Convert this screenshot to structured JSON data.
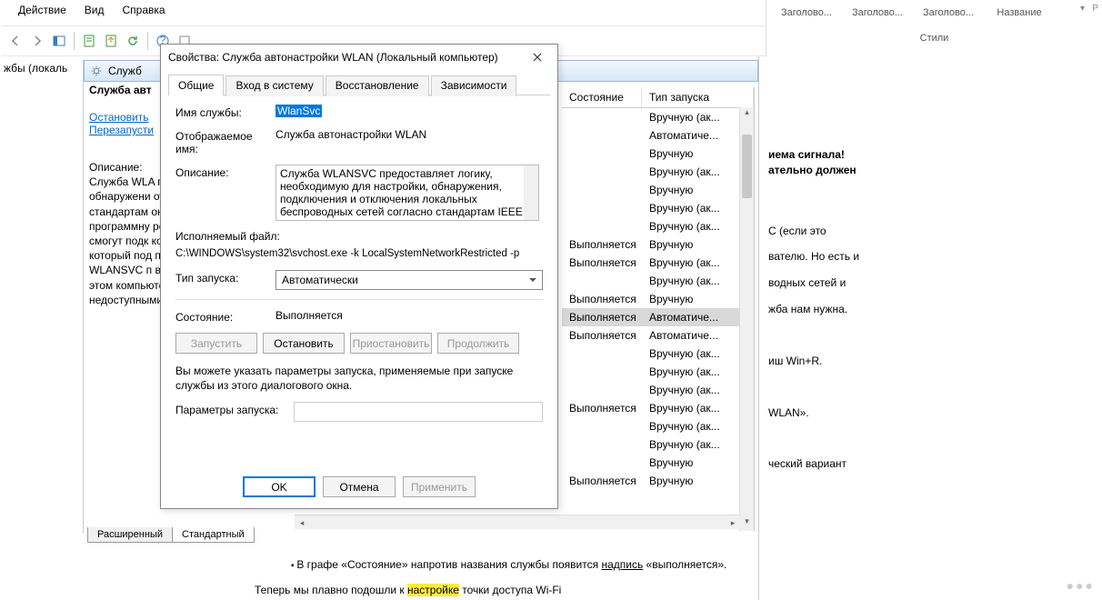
{
  "menu": {
    "action": "Действие",
    "view": "Вид",
    "help": "Справка"
  },
  "styles": {
    "h1": "Заголово...",
    "h2": "Заголово...",
    "h3": "Заголово...",
    "name": "Название",
    "label": "Стили"
  },
  "left_tree": {
    "item": "жбы (локаль"
  },
  "svc_header": {
    "title": "Служб"
  },
  "desc": {
    "title": "Служба авт",
    "stop": "Остановить",
    "restart": "Перезапусти",
    "label": "Описание:",
    "body": "Служба WLA предоставля необходиму обнаружени отключения беспроводн стандартам она содерж превращени программну результате ч устройства н смогут подк компьютеру адаптера бе который под подобную ф или отключ WLANSVC п все адаптер сетей на этом компьютере станут недоступными из раздела"
  },
  "bottom_tabs": {
    "extended": "Расширенный",
    "standard": "Стандартный"
  },
  "columns": {
    "status": "Состояние",
    "startup": "Тип запуска"
  },
  "services": [
    {
      "status": "",
      "startup": "Вручную (ак..."
    },
    {
      "status": "",
      "startup": "Автоматиче..."
    },
    {
      "status": "",
      "startup": "Вручную"
    },
    {
      "status": "",
      "startup": "Вручную (ак..."
    },
    {
      "status": "",
      "startup": "Вручную"
    },
    {
      "status": "",
      "startup": "Вручную (ак..."
    },
    {
      "status": "",
      "startup": "Вручную (ак..."
    },
    {
      "status": "Выполняется",
      "startup": "Вручную"
    },
    {
      "status": "Выполняется",
      "startup": "Вручную (ак..."
    },
    {
      "status": "",
      "startup": "Вручную (ак..."
    },
    {
      "status": "Выполняется",
      "startup": "Вручную"
    },
    {
      "status": "Выполняется",
      "startup": "Автоматиче...",
      "sel": true
    },
    {
      "status": "Выполняется",
      "startup": "Автоматиче..."
    },
    {
      "status": "",
      "startup": "Вручную (ак..."
    },
    {
      "status": "",
      "startup": "Вручную (ак..."
    },
    {
      "status": "",
      "startup": "Вручную (ак..."
    },
    {
      "status": "Выполняется",
      "startup": "Вручную (ак..."
    },
    {
      "status": "",
      "startup": "Вручную (ак..."
    },
    {
      "status": "",
      "startup": "Вручную (ак..."
    },
    {
      "status": "",
      "startup": "Вручную"
    },
    {
      "status": "Выполняется",
      "startup": "Вручную"
    }
  ],
  "dialog": {
    "title": "Свойства: Служба автонастройки WLAN (Локальный компьютер)",
    "tabs": {
      "general": "Общие",
      "logon": "Вход в систему",
      "recovery": "Восстановление",
      "deps": "Зависимости"
    },
    "svc_name_label": "Имя службы:",
    "svc_name": "WlanSvc",
    "disp_name_label": "Отображаемое имя:",
    "disp_name": "Служба автонастройки WLAN",
    "desc_label": "Описание:",
    "desc_text": "Служба WLANSVC предоставляет логику, необходимую для настройки, обнаружения, подключения и отключения локальных беспроводных сетей согласно стандартам IEEE",
    "exe_label": "Исполняемый файл:",
    "exe_path": "C:\\WINDOWS\\system32\\svchost.exe -k LocalSystemNetworkRestricted -p",
    "startup_label": "Тип запуска:",
    "startup_value": "Автоматически",
    "state_label": "Состояние:",
    "state_value": "Выполняется",
    "btn_start": "Запустить",
    "btn_stop": "Остановить",
    "btn_pause": "Приостановить",
    "btn_resume": "Продолжить",
    "note": "Вы можете указать параметры запуска, применяемые при запуске службы из этого диалогового окна.",
    "params_label": "Параметры запуска:",
    "ok": "OK",
    "cancel": "Отмена",
    "apply": "Применить"
  },
  "doc": {
    "l1a": "иема сигнала!",
    "l1b": "ательно должен",
    "l2": "C (если это",
    "l3": "вателю. Но есть и",
    "l4": "водных сетей и",
    "l5": "жба нам нужна.",
    "l6": "иш Win+R.",
    "l7": "WLAN».",
    "l8": "ческий вариант",
    "bullet": "В графе «Состояние» напротив названия службы появится ",
    "bullet_u": "надпись",
    "bullet_end": " «выполняется».",
    "last": "Теперь мы плавно подошли к ",
    "last_hl": "настройке",
    "last_end": " точки доступа Wi-Fi"
  }
}
